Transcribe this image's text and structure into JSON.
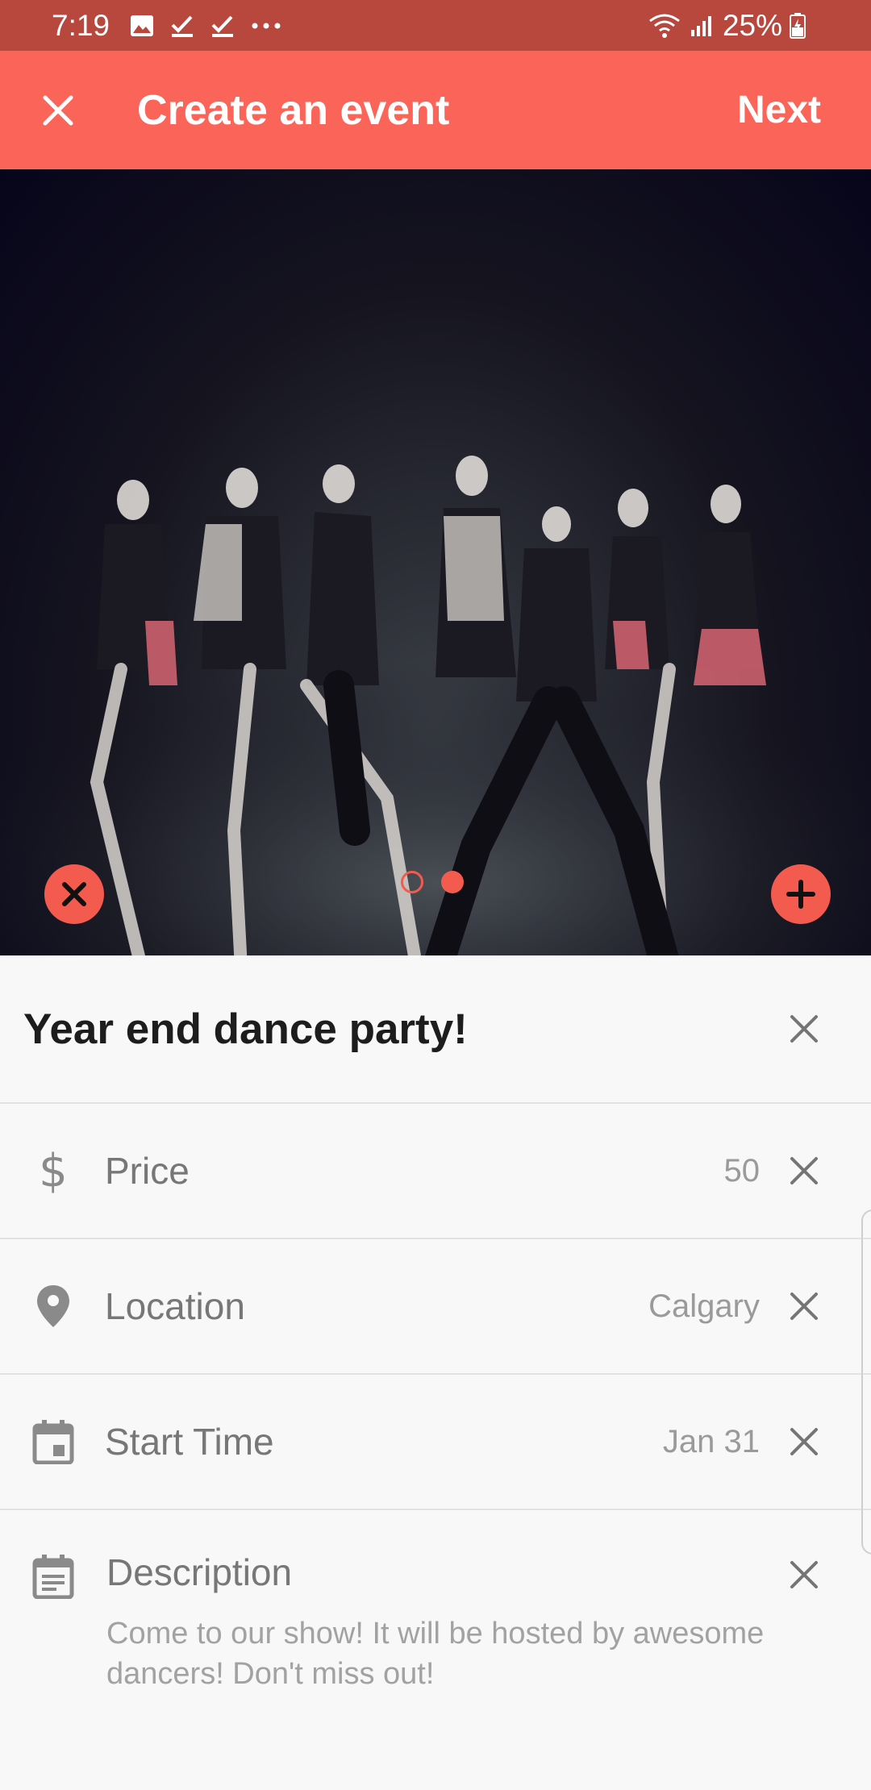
{
  "status_bar": {
    "time": "7:19",
    "battery": "25%",
    "icons": [
      "image-icon",
      "check-icon",
      "check-icon",
      "more-dots-icon",
      "wifi-icon",
      "signal-icon",
      "battery-icon"
    ]
  },
  "app_bar": {
    "title": "Create an event",
    "next_label": "Next",
    "close_icon": "close-icon"
  },
  "carousel": {
    "page_count": 2,
    "current_page": 2,
    "remove_icon": "remove-photo-icon",
    "add_icon": "add-photo-icon"
  },
  "event": {
    "title": "Year end dance party!"
  },
  "fields": {
    "price": {
      "label": "Price",
      "value": "50",
      "icon": "dollar-icon"
    },
    "location": {
      "label": "Location",
      "value": "Calgary",
      "icon": "location-pin-icon"
    },
    "start_time": {
      "label": "Start Time",
      "value": "Jan 31",
      "icon": "calendar-icon"
    },
    "description": {
      "label": "Description",
      "value": "Come to our show! It will be hosted by awesome dancers! Don't miss out!",
      "icon": "notes-icon"
    }
  },
  "colors": {
    "accent": "#fb6458",
    "status_bar": "#b8473e",
    "fab": "#f45b4f"
  }
}
